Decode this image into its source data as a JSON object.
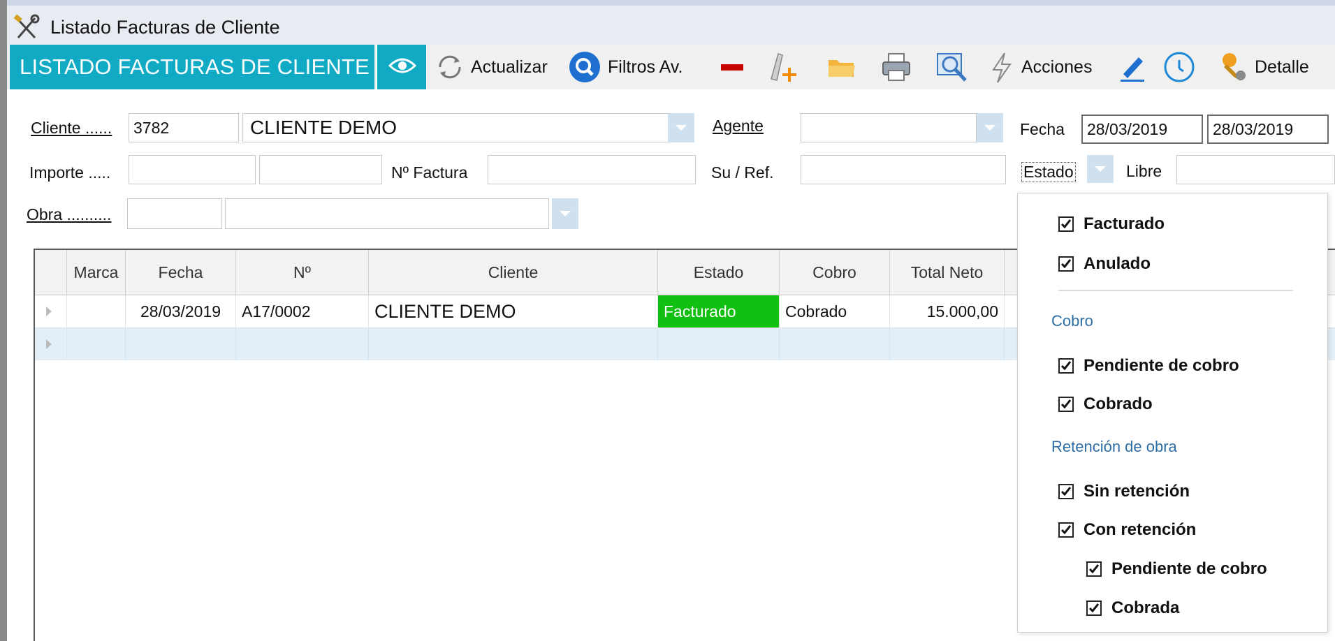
{
  "window": {
    "title": "Listado Facturas de Cliente"
  },
  "toolbar": {
    "brand": "LISTADO FACTURAS DE CLIENTE",
    "actualizar": "Actualizar",
    "filtros": "Filtros Av.",
    "acciones": "Acciones",
    "detalle": "Detalle"
  },
  "filters": {
    "cliente_label": "Cliente ......",
    "cliente_code": "3782",
    "cliente_name": "CLIENTE DEMO",
    "agente_label": "Agente",
    "agente_value": "",
    "fecha_label": "Fecha",
    "fecha_desde": "28/03/2019",
    "fecha_hasta": "28/03/2019",
    "importe_label": "Importe .....",
    "importe_desde": "",
    "importe_hasta": "",
    "nfactura_label": "Nº Factura",
    "nfactura_value": "",
    "suref_label": "Su / Ref.",
    "suref_value": "",
    "estado_label": "Estado",
    "libre_label": "Libre",
    "libre_value": "",
    "obra_label": "Obra ..........",
    "obra_code": "",
    "obra_name": ""
  },
  "grid": {
    "columns": [
      "Marca",
      "Fecha",
      "Nº",
      "Cliente",
      "Estado",
      "Cobro",
      "Total Neto"
    ],
    "rows": [
      {
        "marca": "",
        "fecha": "28/03/2019",
        "numero": "A17/0002",
        "cliente": "CLIENTE DEMO",
        "estado": "Facturado",
        "cobro": "Cobrado",
        "total": "15.000,00"
      }
    ]
  },
  "estado_popup": {
    "estado_items": [
      {
        "label": "Facturado",
        "checked": true
      },
      {
        "label": "Anulado",
        "checked": true
      }
    ],
    "cobro_title": "Cobro",
    "cobro_items": [
      {
        "label": "Pendiente de cobro",
        "checked": true
      },
      {
        "label": "Cobrado",
        "checked": true
      }
    ],
    "retencion_title": "Retención de obra",
    "retencion_items": [
      {
        "label": "Sin retención",
        "checked": true
      },
      {
        "label": "Con retención",
        "checked": true
      }
    ],
    "retencion_sub_items": [
      {
        "label": "Pendiente de cobro",
        "checked": true
      },
      {
        "label": "Cobrada",
        "checked": true
      }
    ]
  },
  "colors": {
    "brand": "#10aac4",
    "estado_facturado_bg": "#11c011",
    "section_title": "#2e6ea6",
    "selected_row": "#e3eff8"
  }
}
